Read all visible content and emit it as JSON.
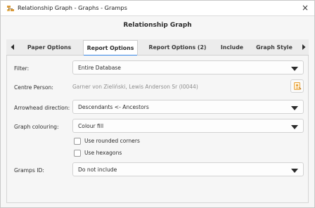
{
  "window": {
    "title": "Relationship Graph - Graphs - Gramps",
    "close_glyph": "×"
  },
  "dialog": {
    "title": "Relationship Graph"
  },
  "tabs": [
    {
      "label": "Paper Options",
      "active": false
    },
    {
      "label": "Report Options",
      "active": true
    },
    {
      "label": "Report Options (2)",
      "active": false
    },
    {
      "label": "Include",
      "active": false
    },
    {
      "label": "Graph Style",
      "active": false
    }
  ],
  "form": {
    "filter": {
      "label": "Filter:",
      "value": "Entire Database"
    },
    "centre_person": {
      "label": "Centre Person:",
      "value": "Garner von Zieliński, Lewis Anderson Sr (I0044)"
    },
    "arrowhead": {
      "label": "Arrowhead direction:",
      "value": "Descendants <- Ancestors"
    },
    "colouring": {
      "label": "Graph colouring:",
      "value": "Colour fill"
    },
    "rounded_corners": {
      "label": "Use rounded corners",
      "checked": false
    },
    "hexagons": {
      "label": "Use hexagons",
      "checked": false
    },
    "gramps_id": {
      "label": "Gramps ID:",
      "value": "Do not include"
    }
  },
  "icons": {
    "app": "gramps-app-icon",
    "tab_left": "chevron-left-icon",
    "tab_right": "chevron-right-icon",
    "combo_arrow": "triangle-down-icon",
    "edit_person": "edit-person-icon"
  },
  "colors": {
    "accent": "#3584e4",
    "edit_icon": "#e8a23a"
  }
}
